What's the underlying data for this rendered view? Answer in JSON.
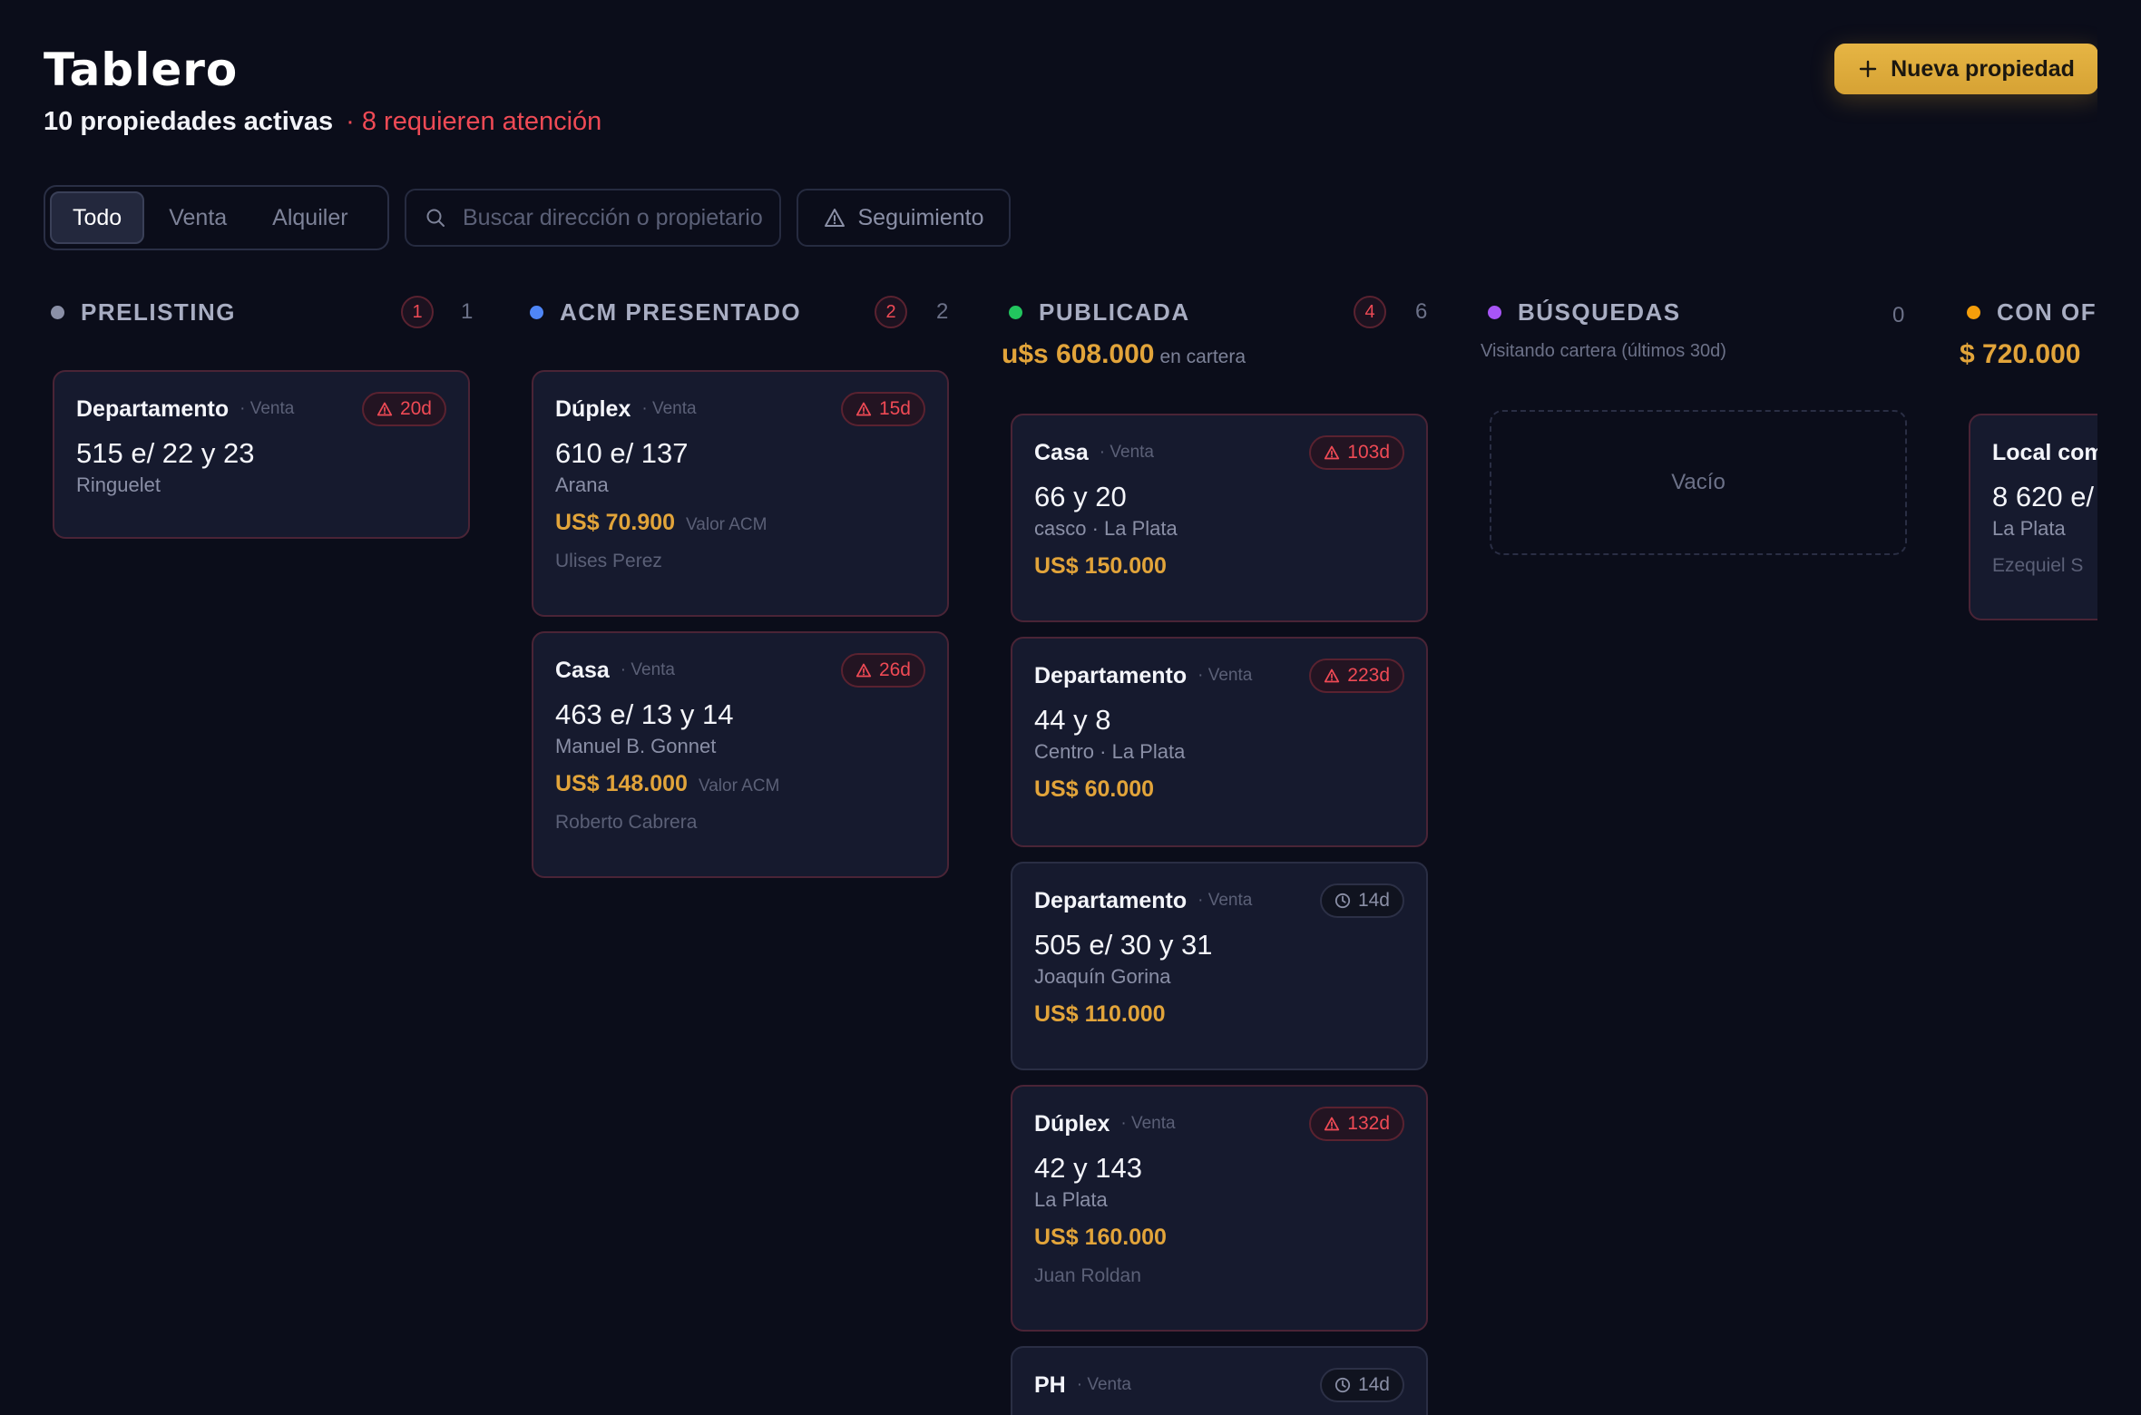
{
  "header": {
    "title": "Tablero",
    "active_count": "10 propiedades activas",
    "attention": "· 8 requieren atención",
    "new_button": "Nueva propiedad"
  },
  "filters": {
    "tabs": [
      "Todo",
      "Venta",
      "Alquiler"
    ],
    "active_tab": "Todo",
    "search_placeholder": "Buscar dirección o propietario",
    "follow_label": "Seguimiento"
  },
  "columns": [
    {
      "title": "PRELISTING",
      "color": "#8a8fa6",
      "alerts": "1",
      "count": "1",
      "cards": [
        {
          "type": "Departamento",
          "op": "· Venta",
          "badge": "20d",
          "badge_kind": "alert",
          "address": "515 e/ 22 y 23",
          "location": "Ringuelet"
        }
      ]
    },
    {
      "title": "ACM PRESENTADO",
      "color": "#4f86f7",
      "alerts": "2",
      "count": "2",
      "cards": [
        {
          "type": "Dúplex",
          "op": "· Venta",
          "badge": "15d",
          "badge_kind": "alert",
          "address": "610 e/ 137",
          "location": "Arana",
          "price": "US$ 70.900",
          "price_note": "Valor ACM",
          "owner": "Ulises Perez"
        },
        {
          "type": "Casa",
          "op": "· Venta",
          "badge": "26d",
          "badge_kind": "alert",
          "address": "463 e/ 13 y 14",
          "location": "Manuel B. Gonnet",
          "price": "US$ 148.000",
          "price_note": "Valor ACM",
          "owner": "Roberto Cabrera"
        }
      ]
    },
    {
      "title": "PUBLICADA",
      "color": "#22c55e",
      "alerts": "4",
      "count": "6",
      "sub_value": "u$s 608.000",
      "sub_note": "en cartera",
      "cards": [
        {
          "type": "Casa",
          "op": "· Venta",
          "badge": "103d",
          "badge_kind": "alert",
          "address": "66 y 20",
          "location": "casco · La Plata",
          "price": "US$ 150.000"
        },
        {
          "type": "Departamento",
          "op": "· Venta",
          "badge": "223d",
          "badge_kind": "alert",
          "address": "44 y 8",
          "location": "Centro · La Plata",
          "price": "US$ 60.000"
        },
        {
          "type": "Departamento",
          "op": "· Venta",
          "badge": "14d",
          "badge_kind": "time",
          "address": "505 e/ 30 y 31",
          "location": "Joaquín Gorina",
          "price": "US$ 110.000"
        },
        {
          "type": "Dúplex",
          "op": "· Venta",
          "badge": "132d",
          "badge_kind": "alert",
          "address": "42 y 143",
          "location": "La Plata",
          "price": "US$ 160.000",
          "owner": "Juan Roldan"
        },
        {
          "type": "PH",
          "op": "· Venta",
          "badge": "14d",
          "badge_kind": "time"
        }
      ]
    },
    {
      "title": "BÚSQUEDAS",
      "color": "#a855f7",
      "count": "0",
      "note": "Visitando cartera (últimos 30d)",
      "empty": "Vacío"
    },
    {
      "title": "CON OFERTA",
      "color": "#f59e0b",
      "sub_value": "$ 720.000",
      "cards": [
        {
          "type": "Local comercial",
          "address": "8 620 e/",
          "location": "La Plata",
          "owner": "Ezequiel S"
        }
      ]
    }
  ],
  "icons": {
    "plus": "plus-icon",
    "search": "search-icon",
    "warning": "warning-triangle-icon",
    "clock": "clock-icon"
  }
}
